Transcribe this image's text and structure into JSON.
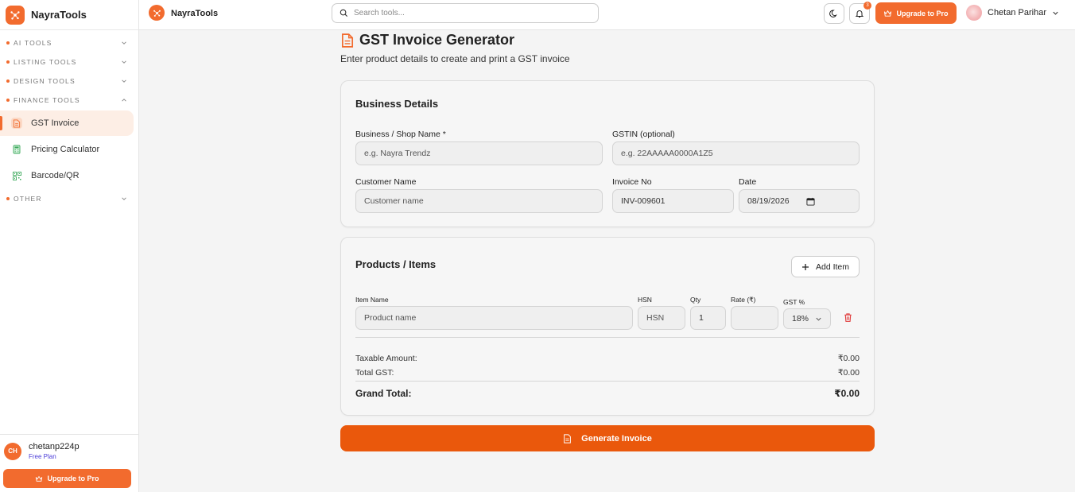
{
  "brand": "NayraTools",
  "sidebar": {
    "sections": [
      {
        "label": "AI TOOLS",
        "expanded": false
      },
      {
        "label": "LISTING TOOLS",
        "expanded": false
      },
      {
        "label": "DESIGN TOOLS",
        "expanded": false
      },
      {
        "label": "FINANCE TOOLS",
        "expanded": true
      },
      {
        "label": "OTHER",
        "expanded": false
      }
    ],
    "finance_items": [
      {
        "label": "GST Invoice",
        "active": true,
        "icon": "document-icon"
      },
      {
        "label": "Pricing Calculator",
        "active": false,
        "icon": "calculator-icon"
      },
      {
        "label": "Barcode/QR",
        "active": false,
        "icon": "qr-code-icon"
      }
    ],
    "footer": {
      "initials": "CH",
      "username": "chetanp224p",
      "plan": "Free Plan",
      "upgrade_label": "Upgrade to Pro"
    }
  },
  "topbar": {
    "brand": "NayraTools",
    "search_placeholder": "Search tools...",
    "notification_count": "3",
    "upgrade_label": "Upgrade to Pro",
    "user_name": "Chetan Parihar"
  },
  "page": {
    "title": "GST Invoice Generator",
    "subtitle": "Enter product details to create and print a GST invoice"
  },
  "business": {
    "title": "Business Details",
    "shop_label": "Business / Shop Name *",
    "shop_placeholder": "e.g. Nayra Trendz",
    "gstin_label": "GSTIN (optional)",
    "gstin_placeholder": "e.g. 22AAAAA0000A1Z5",
    "customer_label": "Customer Name",
    "customer_placeholder": "Customer name",
    "invoice_label": "Invoice No",
    "invoice_value": "INV-009601",
    "date_label": "Date",
    "date_value": "08/19/2026"
  },
  "items": {
    "title": "Products / Items",
    "add_label": "Add Item",
    "col_item": "Item Name",
    "col_hsn": "HSN",
    "col_qty": "Qty",
    "col_rate": "Rate (₹)",
    "col_gst": "GST %",
    "item_placeholder": "Product name",
    "hsn_placeholder": "HSN",
    "qty_value": "1",
    "rate_value": "",
    "gst_value": "18%"
  },
  "summary": {
    "taxable_label": "Taxable Amount:",
    "taxable_value": "₹0.00",
    "gst_label": "Total GST:",
    "gst_value": "₹0.00",
    "grand_label": "Grand Total:",
    "grand_value": "₹0.00"
  },
  "generate_label": "Generate Invoice",
  "colors": {
    "accent": "#f26b2e",
    "generate": "#ea580c"
  }
}
